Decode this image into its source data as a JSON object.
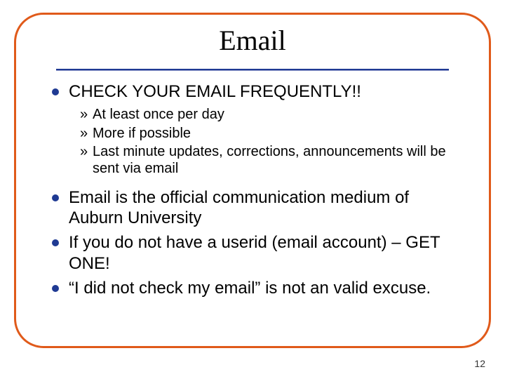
{
  "title": "Email",
  "bullets": [
    {
      "text": "CHECK YOUR EMAIL FREQUENTLY!!",
      "sub": [
        "At least once per day",
        "More if possible",
        "Last minute updates, corrections, announcements will be sent via email"
      ]
    },
    {
      "text": "Email is the official communication medium of Auburn University"
    },
    {
      "text": "If you do not have a userid (email account) – GET ONE!"
    },
    {
      "text": "“I did not check my email” is not an valid excuse."
    }
  ],
  "sub_marker": "»",
  "page_number": "12"
}
